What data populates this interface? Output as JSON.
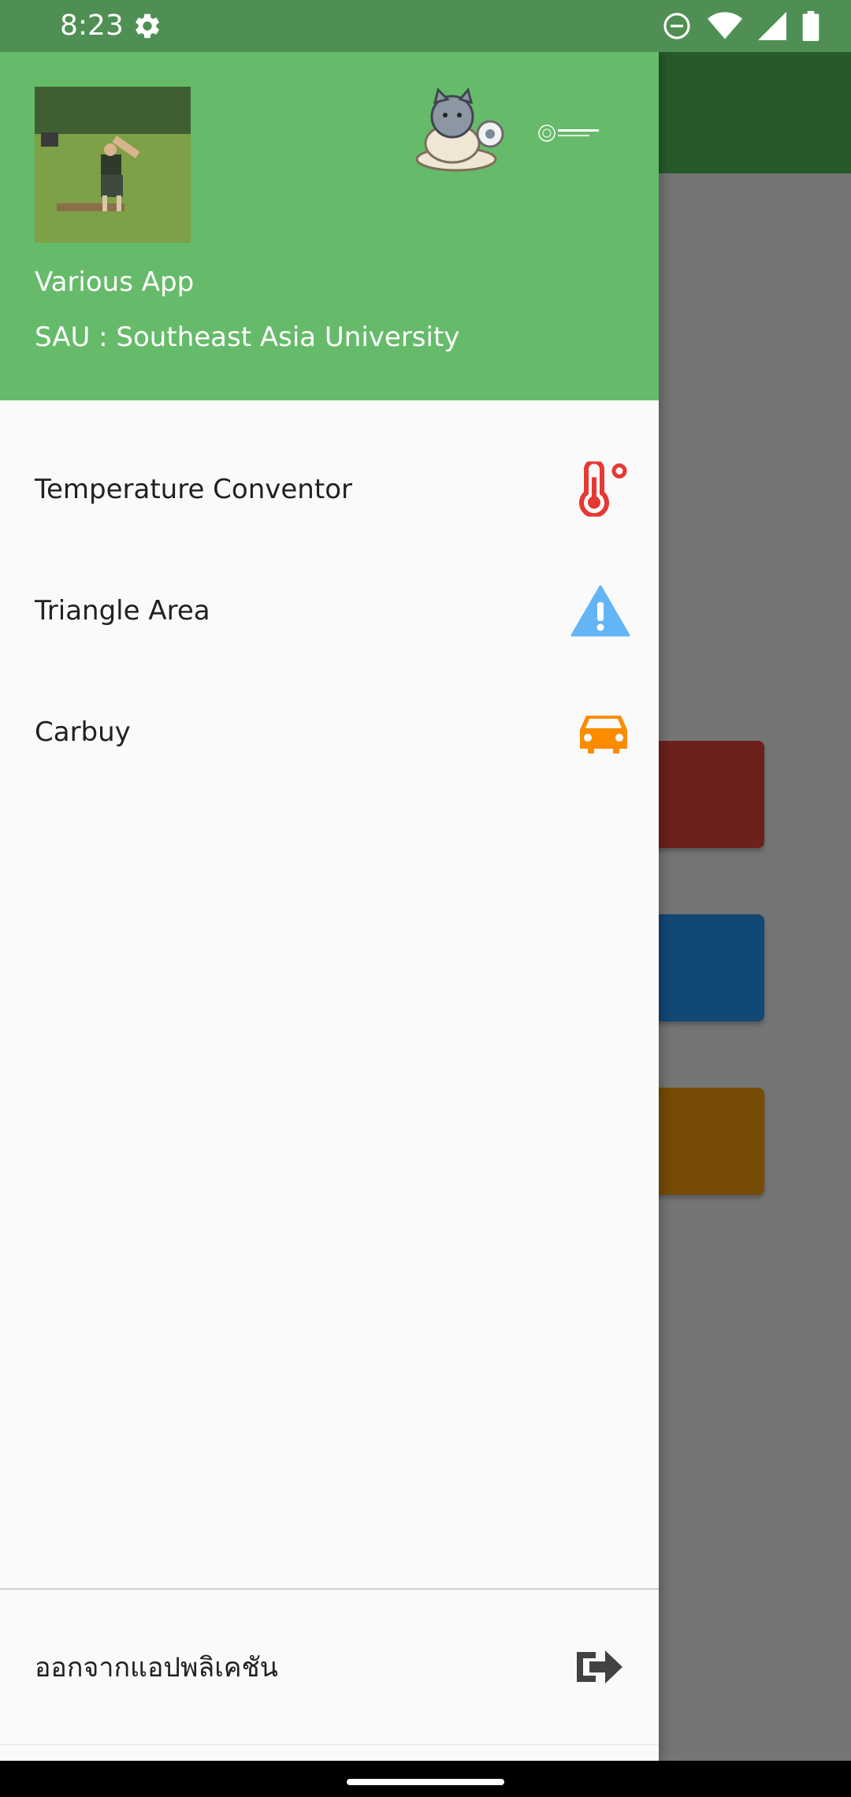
{
  "status_bar": {
    "time": "8:23",
    "icons": [
      "settings-icon",
      "do-not-disturb-icon",
      "wifi-icon",
      "signal-icon",
      "battery-icon"
    ]
  },
  "drawer": {
    "header": {
      "title": "Various App",
      "subtitle": "SAU : Southeast Asia University",
      "avatar": "profile-photo",
      "logos": [
        "cat-mascot-logo",
        "university-logo"
      ]
    },
    "items": [
      {
        "label": "Temperature Conventor",
        "icon": "thermometer-icon",
        "icon_color": "#e53935"
      },
      {
        "label": "Triangle Area",
        "icon": "warning-triangle-icon",
        "icon_color": "#64b5f6"
      },
      {
        "label": "Carbuy",
        "icon": "car-icon",
        "icon_color": "#fb8c00"
      }
    ],
    "logout": {
      "label": "ออกจากแอปพลิเคชัน",
      "icon": "exit-icon",
      "icon_color": "#424242"
    }
  },
  "colors": {
    "header": "#66bb6a",
    "status_bar": "#4f8f53",
    "scrim": "#757575"
  }
}
